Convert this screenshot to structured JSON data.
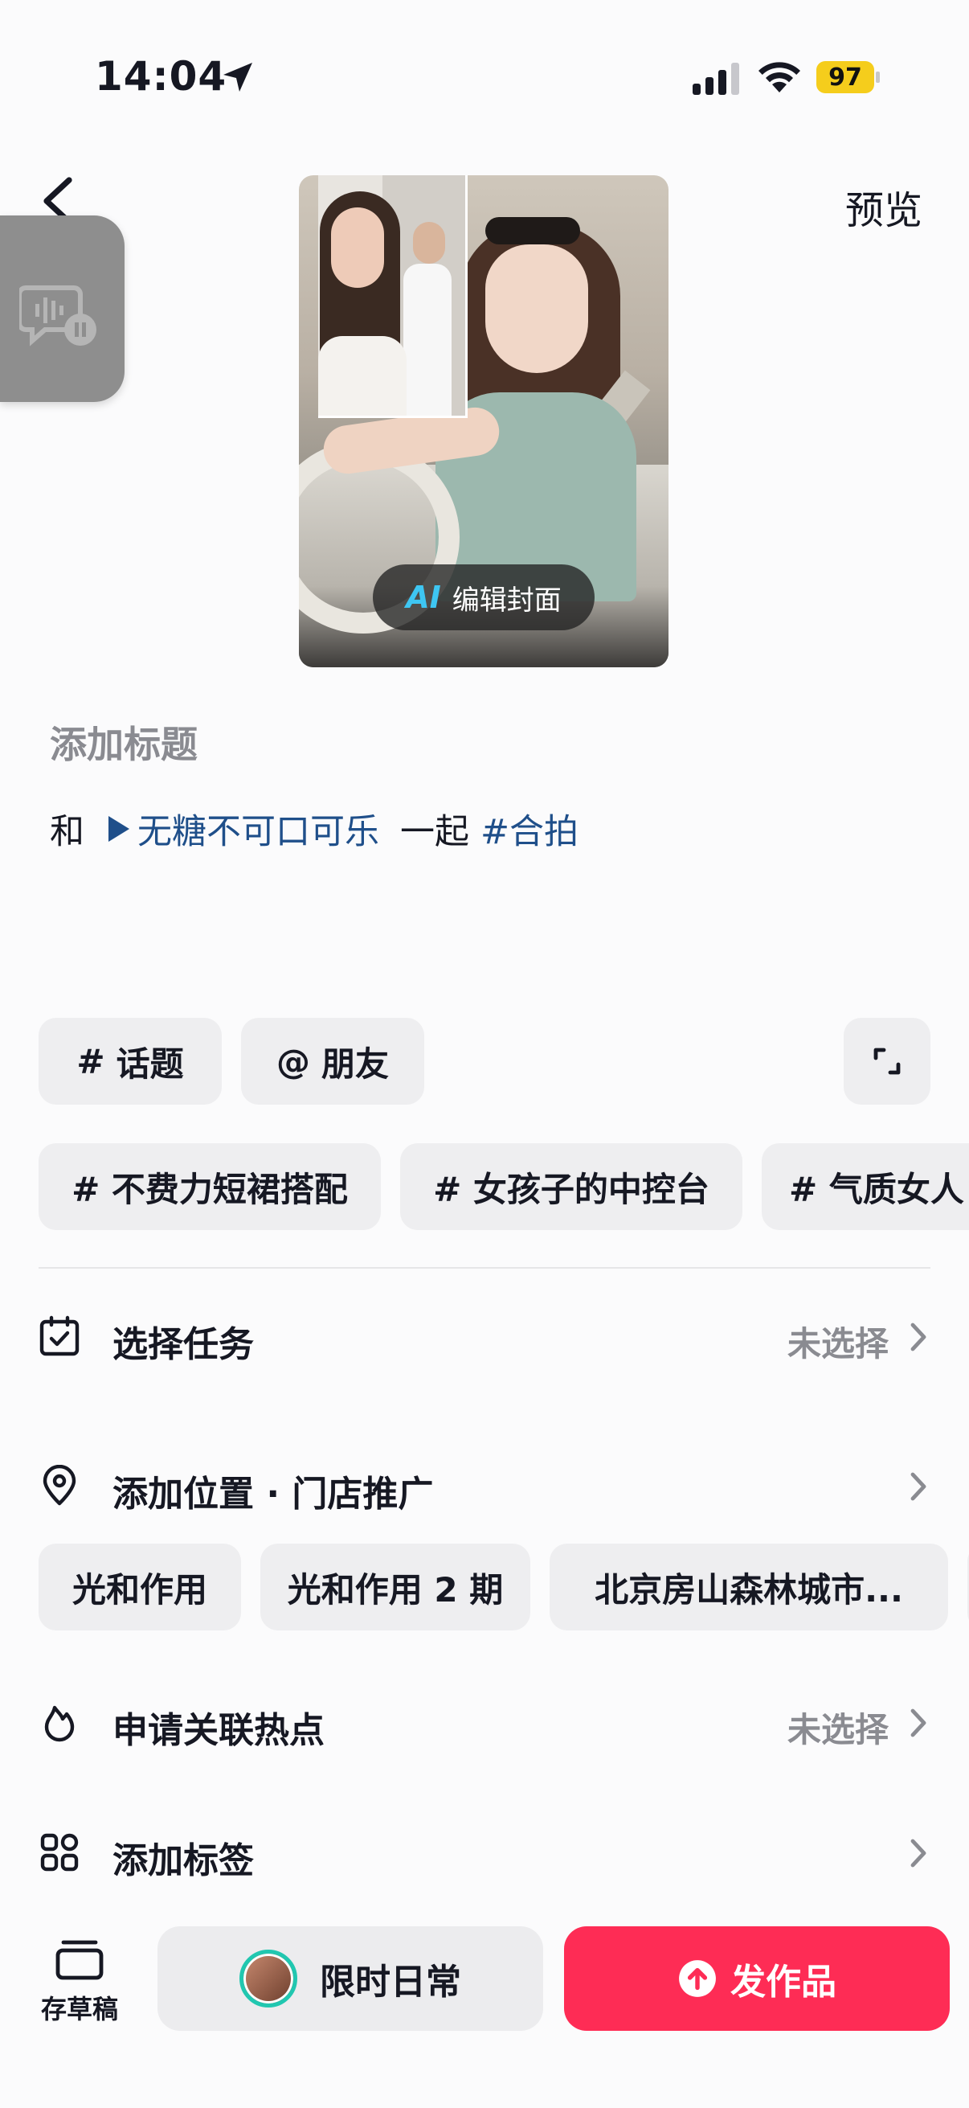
{
  "status_bar": {
    "time": "14:04",
    "battery": "97"
  },
  "nav": {
    "preview_label": "预览"
  },
  "cover": {
    "ai_badge": "AI",
    "edit_label": "编辑封面"
  },
  "title": {
    "placeholder": "添加标题"
  },
  "caption": {
    "prefix": "和",
    "sound_name": "无糖不可口可乐",
    "middle": "一起",
    "hashtag": "#合拍"
  },
  "quick_actions": [
    {
      "symbol": "#",
      "label": "话题"
    },
    {
      "symbol": "@",
      "label": "朋友"
    }
  ],
  "suggested_topics": [
    "# 不费力短裙搭配",
    "# 女孩子的中控台",
    "# 气质女人"
  ],
  "rows": {
    "task": {
      "label": "选择任务",
      "value": "未选择"
    },
    "location": {
      "label": "添加位置 · 门店推广"
    },
    "hotspot": {
      "label": "申请关联热点",
      "value": "未选择"
    },
    "tags": {
      "label": "添加标签"
    }
  },
  "location_chips": [
    "光和作用",
    "光和作用 2 期",
    "北京房山森林城市..."
  ],
  "bottom": {
    "drafts_label": "存草稿",
    "daily_label": "限时日常",
    "publish_label": "发作品"
  },
  "colors": {
    "accent": "#fe2c55",
    "link": "#1f4f8a",
    "battery": "#f5cd1c",
    "ai": "#3ec6f2"
  }
}
